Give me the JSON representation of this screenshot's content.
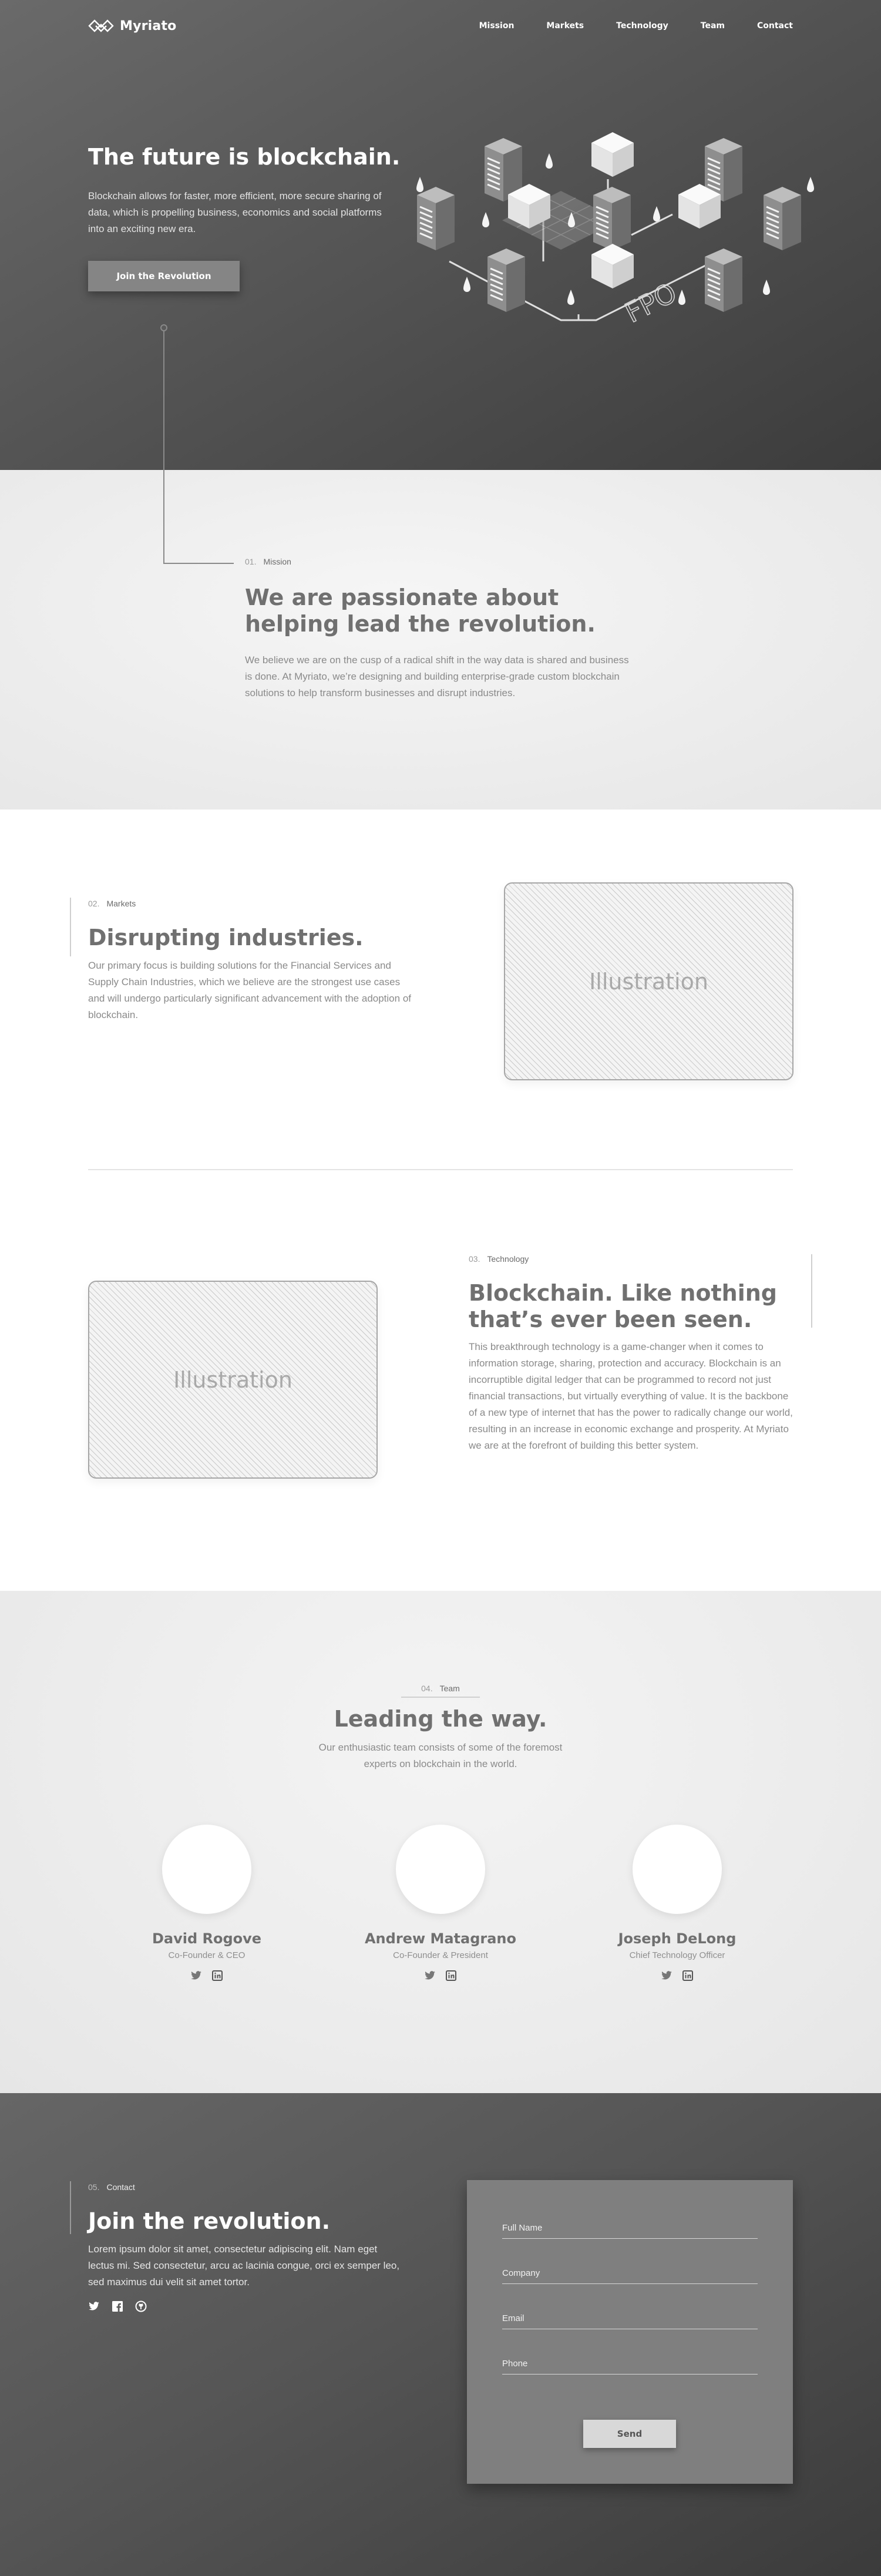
{
  "brand": {
    "name": "Myriato"
  },
  "nav": {
    "items": [
      "Mission",
      "Markets",
      "Technology",
      "Team",
      "Contact"
    ]
  },
  "hero": {
    "title": "The future is blockchain.",
    "body": "Blockchain allows for faster, more efficient, more secure sharing of data, which is propelling business, economics and social platforms into an exciting new era.",
    "cta": "Join the Revolution",
    "art_label": "FPO"
  },
  "mission": {
    "num": "01.",
    "label": "Mission",
    "title": "We are passionate about helping lead the revolution.",
    "body": "We believe we are on the cusp of a radical shift in the way data is shared and business is done. At Myriato, we’re designing and building enterprise-grade custom blockchain solutions to help transform businesses and disrupt industries."
  },
  "markets": {
    "num": "02.",
    "label": "Markets",
    "title": "Disrupting industries.",
    "body": "Our primary focus is building solutions for the Financial Services and Supply Chain Industries, which we believe are the strongest use cases and will undergo particularly significant advancement with the adoption of blockchain.",
    "illustration": "Illustration"
  },
  "technology": {
    "num": "03.",
    "label": "Technology",
    "title": "Blockchain. Like nothing that’s ever been seen.",
    "body": "This breakthrough technology is a game-changer when it comes to information storage, sharing, protection and accuracy. Blockchain is an incorruptible digital ledger that can be programmed to record not just financial transactions, but virtually everything of value. It is the backbone of a new type of internet that has the power to radically change our world, resulting in an increase in economic exchange and prosperity. At Myriato we are at the forefront of building this better system.",
    "illustration": "Illustration"
  },
  "team": {
    "num": "04.",
    "label": "Team",
    "title": "Leading the way.",
    "lead": "Our enthusiastic team consists of some of the foremost experts on blockchain in the world.",
    "members": [
      {
        "name": "David Rogove",
        "role": "Co-Founder & CEO"
      },
      {
        "name": "Andrew Matagrano",
        "role": "Co-Founder & President"
      },
      {
        "name": "Joseph DeLong",
        "role": "Chief Technology Officer"
      }
    ]
  },
  "contact": {
    "num": "05.",
    "label": "Contact",
    "title": "Join the revolution.",
    "body": "Lorem ipsum dolor sit amet, consectetur adipiscing elit. Nam eget lectus mi. Sed consectetur, arcu ac lacinia congue, orci ex semper leo, sed maximus dui velit sit amet tortor.",
    "form": {
      "full_name": "Full Name",
      "company": "Company",
      "email": "Email",
      "phone": "Phone",
      "send": "Send"
    }
  },
  "colors": {
    "hero_dark": "#555555",
    "panel": "#7f7f7f",
    "text_gray": "#8a8a8a",
    "heading_gray": "#707070"
  }
}
